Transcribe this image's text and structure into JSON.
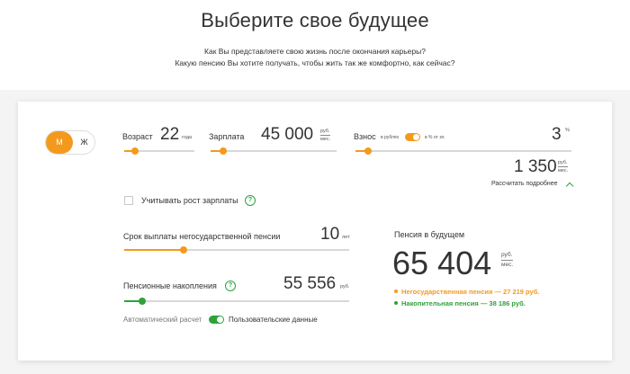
{
  "header": {
    "title": "Выберите свое будущее",
    "subtitle_1": "Как Вы представляете свою жизнь после окончания карьеры?",
    "subtitle_2": "Какую пенсию Вы хотите получать, чтобы жить так же комфортно, как сейчас?"
  },
  "gender": {
    "male": "М",
    "female": "Ж",
    "selected": "М"
  },
  "age": {
    "label": "Возраст",
    "value": "22",
    "unit": "года",
    "slider_fraction": 0.1
  },
  "salary": {
    "label": "Зарплата",
    "value": "45 000",
    "unit_top": "руб.",
    "unit_bottom": "мес.",
    "slider_fraction": 0.08
  },
  "contribution": {
    "label": "Взнос",
    "toggle_left": "в рублях",
    "toggle_right": "в % от зп.",
    "percent_value": "3",
    "percent_unit": "%",
    "amount_value": "1 350",
    "amount_unit_top": "руб.",
    "amount_unit_bottom": "мес.",
    "details_link": "Рассчитать подробнее",
    "slider_fraction": 0.05
  },
  "salary_growth": {
    "label": "Учитывать рост зарплаты",
    "help": "?",
    "checked": false
  },
  "payout_period": {
    "label": "Срок выплаты негосударственной пенсии",
    "value": "10",
    "unit": "лет",
    "slider_fraction": 0.27
  },
  "savings": {
    "label": "Пенсионные накопления",
    "help": "?",
    "value": "55 556",
    "unit": "руб.",
    "slider_fraction": 0.09
  },
  "auto_calc": {
    "label_left": "Автоматический расчет",
    "label_right": "Пользовательские данные"
  },
  "result": {
    "label": "Пенсия в будущем",
    "value": "65 404",
    "unit_top": "руб.",
    "unit_bottom": "мес.",
    "legend_nonstate": "Негосударственная пенсия — 27 219 руб.",
    "legend_funded": "Накопительная пенсия — 38 186 руб."
  },
  "colors": {
    "accent_orange": "#f39a1e",
    "accent_green": "#2ea23b",
    "track": "#d8d8d8"
  }
}
